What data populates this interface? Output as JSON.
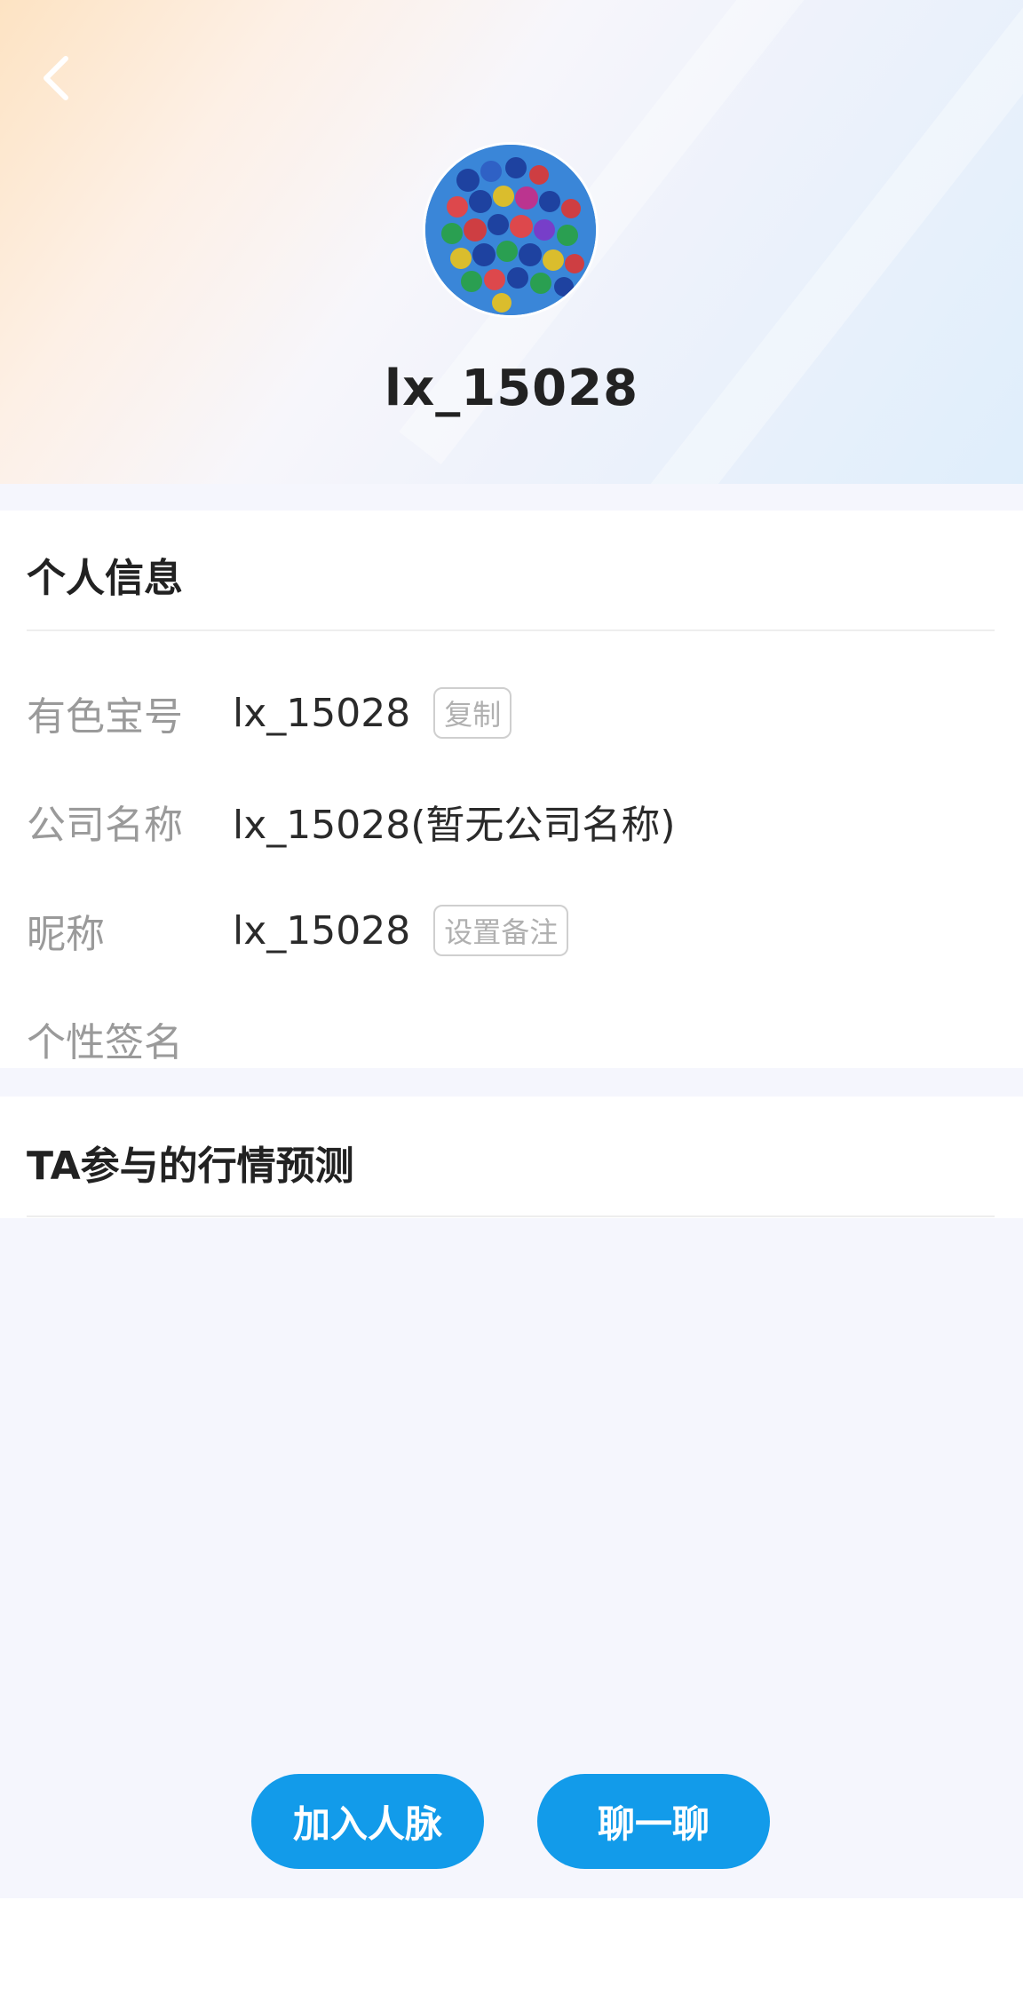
{
  "header": {
    "username": "lx_15028"
  },
  "personal_info": {
    "title": "个人信息",
    "rows": [
      {
        "label": "有色宝号",
        "value": "lx_15028",
        "tag": "复制"
      },
      {
        "label": "公司名称",
        "value": "lx_15028(暂无公司名称)"
      },
      {
        "label": "昵称",
        "value": "lx_15028",
        "tag": "设置备注"
      },
      {
        "label": "个性签名",
        "value": ""
      }
    ]
  },
  "predictions": {
    "title": "TA参与的行情预测"
  },
  "actions": {
    "add_contact": "加入人脉",
    "chat": "聊一聊"
  },
  "icons": {
    "back": "chevron-left-icon",
    "avatar": "balloons-avatar"
  },
  "colors": {
    "primary_button": "#129bea",
    "label_text": "#9a9a9a",
    "page_background": "#f5f6fd"
  }
}
